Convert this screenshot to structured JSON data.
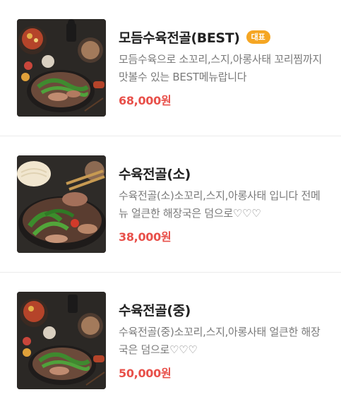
{
  "menu": {
    "items": [
      {
        "name": "모듬수육전골(BEST)",
        "badge": "대표",
        "description": "모듬수육으로 소꼬리,스지,아롱사태 꼬리찜까지 맛볼수 있는 BEST메뉴랍니다",
        "price": "68,000원",
        "image": "hotpot-spread-photo"
      },
      {
        "name": "수육전골(소)",
        "badge": "",
        "description": "수육전골(소)소꼬리,스지,아롱사태 입니다 전메뉴 얼큰한 해장국은 덤으로♡♡♡",
        "price": "38,000원",
        "image": "hotpot-closeup-photo"
      },
      {
        "name": "수육전골(중)",
        "badge": "",
        "description": "수육전골(중)소꼬리,스지,아롱사태 얼큰한 해장국은 덤으로♡♡♡",
        "price": "50,000원",
        "image": "hotpot-spread-photo"
      }
    ]
  },
  "colors": {
    "price": "#e8504a",
    "badge": "#f5a623",
    "title": "#222222",
    "description": "#7a7a7a"
  }
}
